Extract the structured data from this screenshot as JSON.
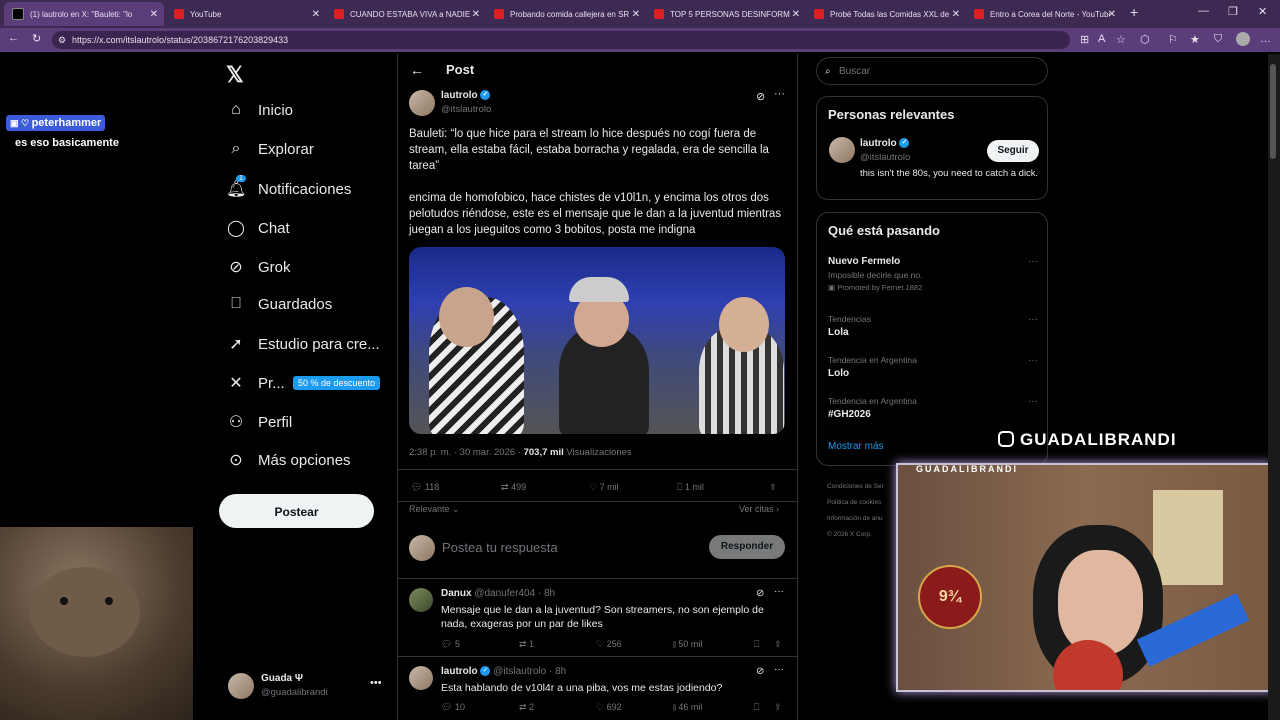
{
  "browser": {
    "tabs": [
      {
        "label": "(1) lautrolo en X: \"Bauleti: \"lo",
        "active": true
      },
      {
        "label": "YouTube"
      },
      {
        "label": "CUANDO ESTABA VIVA a NADIE le"
      },
      {
        "label": "Probando comida callejera en SR"
      },
      {
        "label": "TOP 5 PERSONAS DESINFORMADAS"
      },
      {
        "label": "Probé Todas las Comidas XXL de"
      },
      {
        "label": "Entro a Corea del Norte - YouTube"
      }
    ],
    "url": "https://x.com/itslautrolo/status/2038672176203829433",
    "accent": "#5b3d7a"
  },
  "stream_overlay": {
    "chat_user": "peterhammer",
    "chat_message": "es eso basicamente",
    "instagram_handle": "GUADALIBRANDI",
    "cam_label": "GUADALIBRANDI"
  },
  "sidebar": {
    "items": [
      {
        "label": "Inicio",
        "icon": "home-icon"
      },
      {
        "label": "Explorar",
        "icon": "search-icon"
      },
      {
        "label": "Notificaciones",
        "icon": "bell-icon",
        "badge": "1"
      },
      {
        "label": "Chat",
        "icon": "chat-icon"
      },
      {
        "label": "Grok",
        "icon": "grok-icon"
      },
      {
        "label": "Guardados",
        "icon": "bookmark-icon"
      },
      {
        "label": "Estudio para cre...",
        "icon": "rocket-icon"
      },
      {
        "label": "Pr...",
        "icon": "x-premium-icon"
      },
      {
        "label": "Perfil",
        "icon": "person-icon"
      },
      {
        "label": "Más opciones",
        "icon": "more-circle-icon"
      }
    ],
    "promo": "50 % de descuento",
    "post_button": "Postear",
    "account": {
      "name": "Guada Ψ",
      "handle": "@guadalibrandi"
    }
  },
  "post": {
    "header": "Post",
    "author": {
      "name": "lautrolo",
      "handle": "@itslautrolo"
    },
    "text1": "Bauleti: “lo que hice para el stream lo hice después no cogí fuera de stream, ella estaba fácil, estaba borracha y regalada, era de sencilla la tarea”",
    "text2": "encima de homofobico, hace chistes de v10l1n, y encima los otros dos pelotudos riéndose, este es el mensaje que le dan a la juventud mientras juegan a los jueguitos como 3 bobitos, posta me indigna",
    "timestamp": "2:38 p. m. · 30 mar. 2026 ·",
    "views": "703,7 mil",
    "views_label": "Visualizaciones",
    "replies": "118",
    "reposts": "499",
    "likes": "7 mil",
    "bookmarks": "1 mil",
    "sort_label": "Relevante",
    "quotes_label": "Ver citas",
    "reply_placeholder": "Postea tu respuesta",
    "reply_button": "Responder"
  },
  "replies": [
    {
      "name": "Danux",
      "handle": "@danufer404 · 8h",
      "text": "Mensaje que le dan a la juventud? Son streamers, no son ejemplo de nada, exageras por un par de likes",
      "replies": "5",
      "reposts": "1",
      "likes": "256",
      "views": "50 mil"
    },
    {
      "name": "lautrolo",
      "handle": "@itslautrolo · 8h",
      "text": "Esta hablando de v10l4r a una piba, vos me estas jodiendo?",
      "replies": "10",
      "reposts": "2",
      "likes": "692",
      "views": "46 mil"
    }
  ],
  "right": {
    "search_placeholder": "Buscar",
    "relevant_title": "Personas relevantes",
    "relevant": {
      "name": "lautrolo",
      "handle": "@itslautrolo",
      "bio": "this isn't the 80s, you need to catch a dick.",
      "follow": "Seguir"
    },
    "trending_title": "Qué está pasando",
    "trends": [
      {
        "cat": "",
        "title": "Nuevo Fermelo",
        "sub": "Imposible decirle que no.",
        "promo": "Promoted by Fernet 1882"
      },
      {
        "cat": "Tendencias",
        "title": "Lola"
      },
      {
        "cat": "Tendencia en Argentina",
        "title": "Lolo"
      },
      {
        "cat": "Tendencia en Argentina",
        "title": "#GH2026"
      }
    ],
    "show_more": "Mostrar más",
    "footer": [
      "Condiciones de Ser",
      "Política de cookies",
      "Información de anu",
      "© 2026 X Corp."
    ]
  }
}
